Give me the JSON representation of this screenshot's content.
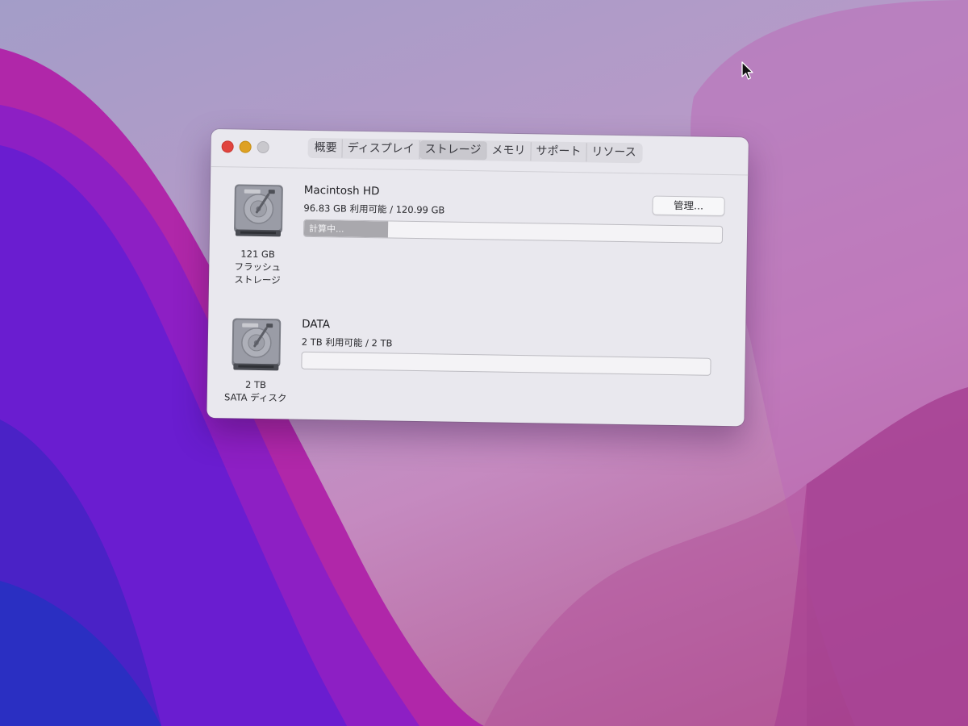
{
  "window": {
    "tabs": [
      {
        "label": "概要",
        "active": false
      },
      {
        "label": "ディスプレイ",
        "active": false
      },
      {
        "label": "ストレージ",
        "active": true
      },
      {
        "label": "メモリ",
        "active": false
      },
      {
        "label": "サポート",
        "active": false
      },
      {
        "label": "リソース",
        "active": false
      }
    ]
  },
  "drives": [
    {
      "name": "Macintosh HD",
      "usage": "96.83 GB 利用可能 / 120.99 GB",
      "caption_size": "121 GB",
      "caption_type_line1": "フラッシュ",
      "caption_type_line2": "ストレージ",
      "bar_label": "計算中...",
      "bar_fraction": 0.2,
      "manage_label": "管理..."
    },
    {
      "name": "DATA",
      "usage": "2 TB 利用可能 / 2 TB",
      "caption_size": "2 TB",
      "caption_type_line1": "SATA ディスク",
      "bar_fraction": 0
    }
  ],
  "icons": {
    "close": "close-button-icon",
    "minimize": "minimize-button-icon",
    "zoom": "zoom-button-icon",
    "drive": "hard-drive-icon",
    "pointer": "mouse-pointer-icon"
  },
  "colors": {
    "close": "#e0443e",
    "minimize": "#dea123",
    "zoom": "#c9c8cd",
    "window_bg": "#e9e8ee",
    "bar_fill": "#a9a8ad"
  }
}
